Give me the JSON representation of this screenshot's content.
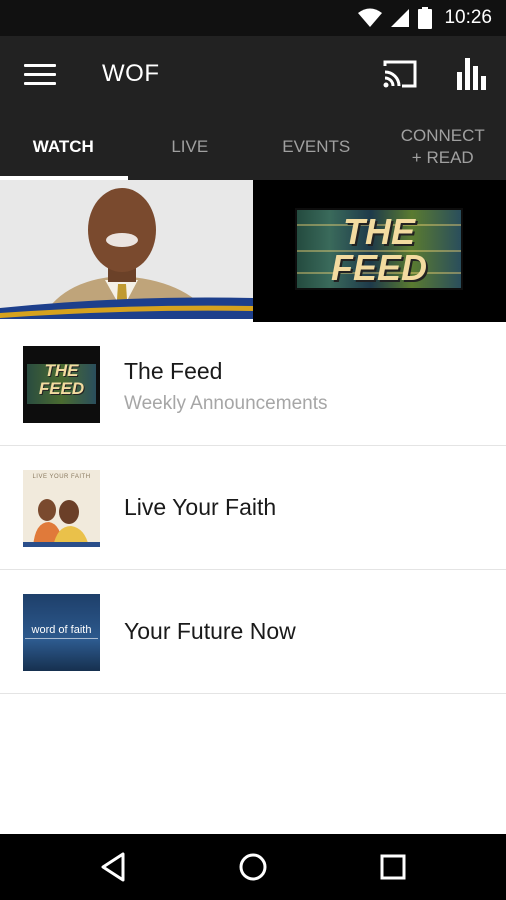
{
  "status_bar": {
    "time": "10:26"
  },
  "app_bar": {
    "title": "WOF",
    "icons": [
      "menu-icon",
      "cast-icon",
      "bar-chart-icon"
    ]
  },
  "tabs": [
    {
      "label": "WATCH",
      "active": true
    },
    {
      "label": "LIVE",
      "active": false
    },
    {
      "label": "EVENTS",
      "active": false
    },
    {
      "label": "CONNECT\n+ READ",
      "active": false
    }
  ],
  "hero": {
    "feed_logo_text": "THE FEED"
  },
  "list": [
    {
      "title": "The Feed",
      "subtitle": "Weekly Announcements",
      "thumb_text": "THE FEED"
    },
    {
      "title": "Live Your Faith",
      "thumb_text": "LIVE YOUR FAITH"
    },
    {
      "title": "Your Future Now",
      "thumb_text": "word of faith"
    }
  ],
  "colors": {
    "app_bar": "#222222",
    "status_bar": "#111111",
    "tab_active": "#ffffff",
    "tab_inactive": "#a0a0a0",
    "subtitle": "#a6a6a6"
  }
}
